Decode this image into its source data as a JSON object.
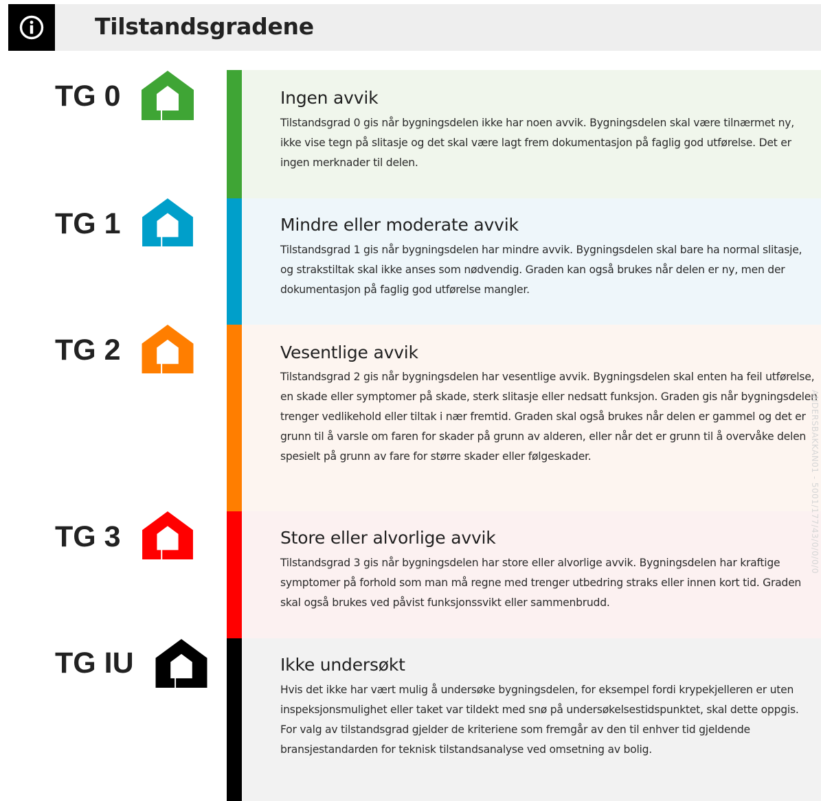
{
  "header": {
    "title": "Tilstandsgradene",
    "icon": "info-icon"
  },
  "grades": [
    {
      "label": "TG 0",
      "title": "Ingen avvik",
      "text": "Tilstandsgrad 0 gis når bygningsdelen ikke har noen avvik. Bygningsdelen skal være tilnærmet ny, ikke vise tegn på slitasje og det skal være lagt frem dokumentasjon på faglig god utførelse. Det er ingen merknader til delen.",
      "color": "#3fa535",
      "panel_color": "#f0f6ec",
      "icon": "house-icon"
    },
    {
      "label": "TG 1",
      "title": "Mindre eller moderate avvik",
      "text": "Tilstandsgrad 1 gis når bygningsdelen har mindre avvik. Bygningsdelen skal bare ha normal slitasje, og strakstiltak skal ikke anses som nødvendig. Graden kan også brukes når delen er ny, men der dokumentasjon på faglig god utførelse mangler.",
      "color": "#009fca",
      "panel_color": "#eef6fa",
      "icon": "house-icon"
    },
    {
      "label": "TG 2",
      "title": "Vesentlige avvik",
      "text": "Tilstandsgrad 2 gis når bygningsdelen har vesentlige avvik. Bygningsdelen skal enten ha feil utførelse, en skade eller symptomer på skade, sterk slitasje eller nedsatt funksjon. Graden gis når bygningsdelen trenger vedlikehold eller tiltak i nær fremtid. Graden skal også brukes når delen er gammel og det er grunn til å varsle om faren for skader på grunn av alderen, eller når det er grunn til å overvåke delen spesielt på grunn av fare for større skader eller følgeskader.",
      "color": "#ff7e00",
      "panel_color": "#fdf5f0",
      "icon": "house-icon"
    },
    {
      "label": "TG 3",
      "title": "Store eller alvorlige avvik",
      "text": "Tilstandsgrad 3 gis når bygningsdelen har store eller alvorlige avvik. Bygningsdelen har kraftige symptomer på forhold som man må regne med trenger utbedring straks eller innen kort tid. Graden skal også brukes ved påvist funksjonssvikt eller sammenbrudd.",
      "color": "#ff0000",
      "panel_color": "#fcf1f1",
      "icon": "house-icon"
    },
    {
      "label": "TG IU",
      "title": "Ikke undersøkt",
      "text": "Hvis det ikke har vært mulig å undersøke bygningsdelen, for eksempel fordi krypekjelleren er uten inspeksjonsmulighet eller taket var tildekt med snø på undersøkelsestidspunktet, skal dette oppgis. For valg av tilstandsgrad gjelder de kriteriene som fremgår av den til enhver tid gjeldende bransjestandarden for teknisk tilstandsanalyse ved omsetning av bolig.",
      "color": "#000000",
      "panel_color": "#f2f2f2",
      "icon": "house-icon"
    }
  ],
  "watermark": "ANDERSBAKKAN01 - 5001/177/43/0/0/0/0"
}
